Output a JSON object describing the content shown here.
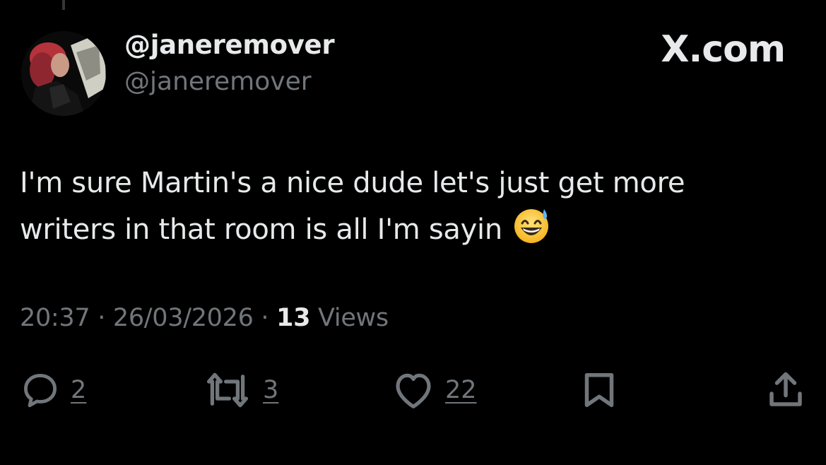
{
  "tweet": {
    "display_name": "@janeremover",
    "handle": "@janeremover",
    "brand": "X.com",
    "text_line_1": "I'm sure Martin's a nice dude let's just get more",
    "text_line_2": "writers in that room is all I'm sayin",
    "emoji": "grinning-face-with-sweat-icon",
    "time": "20:37",
    "sep": "·",
    "date": "26/03/2026",
    "views_count": "13",
    "views_label": "Views"
  },
  "actions": {
    "replies": "2",
    "reposts": "3",
    "likes": "22"
  },
  "icons": {
    "reply": "reply-icon",
    "repost": "repost-icon",
    "like": "heart-icon",
    "bookmark": "bookmark-icon",
    "share": "share-icon"
  },
  "colors": {
    "background": "#000000",
    "primary_text": "#e7e9ea",
    "secondary_text": "#71767b"
  }
}
